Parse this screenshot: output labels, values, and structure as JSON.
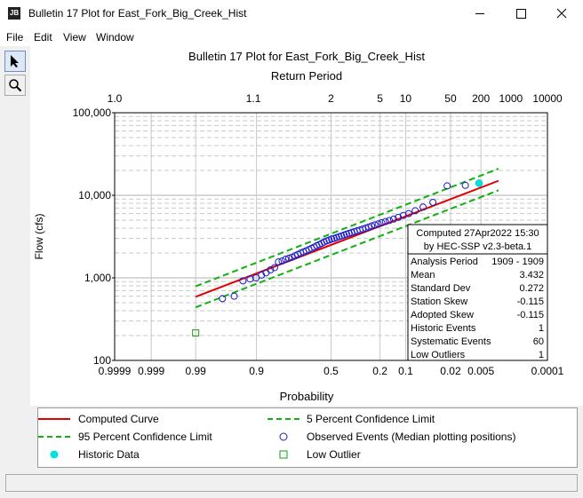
{
  "window": {
    "icon_text": "JB",
    "title": "Bulletin 17 Plot for East_Fork_Big_Creek_Hist"
  },
  "menu": [
    "File",
    "Edit",
    "View",
    "Window"
  ],
  "colors": {
    "computed": "#e00000",
    "confidence": "#10b010",
    "observed": "#1c1cc8",
    "historic": "#00e0e0",
    "outlier": "#10a010"
  },
  "chart_data": {
    "type": "scatter",
    "title": "Bulletin 17 Plot for East_Fork_Big_Creek_Hist",
    "xlabel": "Probability",
    "x2label": "Return Period",
    "ylabel": "Flow (cfs)",
    "yscale": "log",
    "ylim": [
      100,
      100000
    ],
    "y_ticks": [
      100,
      1000,
      10000,
      100000
    ],
    "y_tick_labels": [
      "100",
      "1,000",
      "10,000",
      "100,000"
    ],
    "x_ticks": [
      0.9999,
      0.999,
      0.99,
      0.9,
      0.5,
      0.2,
      0.1,
      0.02,
      0.005,
      0.0001
    ],
    "x_tick_labels": [
      "0.9999",
      "0.999",
      "0.99",
      "0.9",
      "0.5",
      "0.2",
      "0.1",
      "0.02",
      "0.005",
      "0.0001"
    ],
    "top_ticks": [
      1.0,
      1.1,
      2,
      5,
      10,
      50,
      200,
      1000,
      10000
    ],
    "top_tick_labels": [
      "1.0",
      "1.1",
      "2",
      "5",
      "10",
      "50",
      "200",
      "1000",
      "10000"
    ],
    "series": [
      {
        "name": "Computed Curve",
        "type": "line",
        "x": [
          0.99,
          0.002
        ],
        "y": [
          590,
          15000
        ]
      },
      {
        "name": "5 Percent Confidence Limit",
        "type": "line",
        "x": [
          0.99,
          0.002
        ],
        "y": [
          790,
          21000
        ]
      },
      {
        "name": "95 Percent Confidence Limit",
        "type": "line",
        "x": [
          0.99,
          0.002
        ],
        "y": [
          440,
          11500
        ]
      },
      {
        "name": "Observed Events (Median plotting positions)",
        "type": "scatter",
        "x": [
          0.969,
          0.952,
          0.935,
          0.918,
          0.901,
          0.884,
          0.868,
          0.851,
          0.834,
          0.817,
          0.8,
          0.783,
          0.766,
          0.749,
          0.732,
          0.716,
          0.699,
          0.682,
          0.665,
          0.648,
          0.631,
          0.614,
          0.597,
          0.58,
          0.564,
          0.547,
          0.53,
          0.513,
          0.496,
          0.479,
          0.462,
          0.445,
          0.428,
          0.411,
          0.395,
          0.378,
          0.361,
          0.344,
          0.327,
          0.31,
          0.293,
          0.276,
          0.259,
          0.243,
          0.226,
          0.209,
          0.192,
          0.175,
          0.158,
          0.141,
          0.124,
          0.107,
          0.091,
          0.074,
          0.057,
          0.04,
          0.023,
          0.0105
        ],
        "y": [
          560,
          600,
          920,
          970,
          1000,
          1080,
          1150,
          1250,
          1330,
          1560,
          1600,
          1680,
          1730,
          1780,
          1850,
          1920,
          2000,
          2060,
          2130,
          2200,
          2280,
          2360,
          2450,
          2530,
          2620,
          2710,
          2800,
          2870,
          2950,
          3000,
          3080,
          3150,
          3220,
          3300,
          3380,
          3460,
          3540,
          3620,
          3710,
          3800,
          3900,
          4000,
          4120,
          4250,
          4380,
          4500,
          4650,
          4800,
          4960,
          5150,
          5400,
          5700,
          6000,
          6500,
          7200,
          8200,
          13000,
          13200
        ]
      },
      {
        "name": "Historic Data",
        "type": "scatter",
        "x": [
          0.0055
        ],
        "y": [
          14000
        ]
      },
      {
        "name": "Low Outlier",
        "type": "scatter",
        "x": [
          0.99
        ],
        "y": [
          215
        ]
      }
    ],
    "legend": [
      "Computed Curve",
      "5 Percent Confidence Limit",
      "95 Percent Confidence Limit",
      "Observed Events (Median plotting positions)",
      "Historic Data",
      "Low Outlier"
    ],
    "stats_header": [
      "Computed 27Apr2022 15:30",
      "by HEC-SSP v2.3-beta.1"
    ],
    "stats": [
      {
        "label": "Analysis Period",
        "value": "1909 - 1909"
      },
      {
        "label": "Mean",
        "value": "3.432"
      },
      {
        "label": "Standard Dev",
        "value": "0.272"
      },
      {
        "label": "Station Skew",
        "value": "-0.115"
      },
      {
        "label": "Adopted Skew",
        "value": "-0.115"
      },
      {
        "label": "Historic Events",
        "value": "1"
      },
      {
        "label": "Systematic Events",
        "value": "60"
      },
      {
        "label": "Low Outliers",
        "value": "1"
      }
    ]
  }
}
